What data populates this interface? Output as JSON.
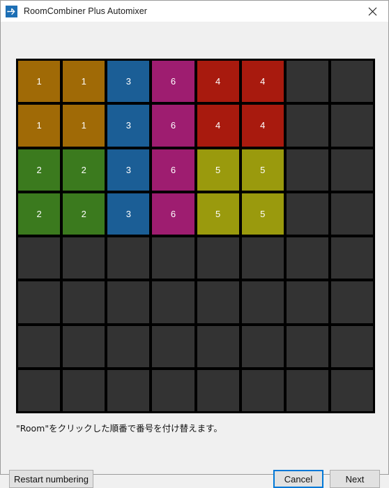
{
  "window": {
    "title": "RoomCombiner Plus Automixer",
    "app_icon": "mixer-node-icon",
    "close_icon": "close-icon"
  },
  "grid": {
    "columns": 8,
    "rows": 8,
    "empty_color": "#333333",
    "gridline_color": "#000000",
    "group_colors": {
      "1": "#a06a06",
      "2": "#3b7a1e",
      "3": "#1b5e96",
      "4": "#a81a0e",
      "5": "#9a9a0d",
      "6": "#9e1d70"
    },
    "cells": [
      [
        {
          "label": "1",
          "color": "#a06a06"
        },
        {
          "label": "1",
          "color": "#a06a06"
        },
        {
          "label": "3",
          "color": "#1b5e96"
        },
        {
          "label": "6",
          "color": "#9e1d70"
        },
        {
          "label": "4",
          "color": "#a81a0e"
        },
        {
          "label": "4",
          "color": "#a81a0e"
        },
        {
          "label": "",
          "color": "#333333"
        },
        {
          "label": "",
          "color": "#333333"
        }
      ],
      [
        {
          "label": "1",
          "color": "#a06a06"
        },
        {
          "label": "1",
          "color": "#a06a06"
        },
        {
          "label": "3",
          "color": "#1b5e96"
        },
        {
          "label": "6",
          "color": "#9e1d70"
        },
        {
          "label": "4",
          "color": "#a81a0e"
        },
        {
          "label": "4",
          "color": "#a81a0e"
        },
        {
          "label": "",
          "color": "#333333"
        },
        {
          "label": "",
          "color": "#333333"
        }
      ],
      [
        {
          "label": "2",
          "color": "#3b7a1e"
        },
        {
          "label": "2",
          "color": "#3b7a1e"
        },
        {
          "label": "3",
          "color": "#1b5e96"
        },
        {
          "label": "6",
          "color": "#9e1d70"
        },
        {
          "label": "5",
          "color": "#9a9a0d"
        },
        {
          "label": "5",
          "color": "#9a9a0d"
        },
        {
          "label": "",
          "color": "#333333"
        },
        {
          "label": "",
          "color": "#333333"
        }
      ],
      [
        {
          "label": "2",
          "color": "#3b7a1e"
        },
        {
          "label": "2",
          "color": "#3b7a1e"
        },
        {
          "label": "3",
          "color": "#1b5e96"
        },
        {
          "label": "6",
          "color": "#9e1d70"
        },
        {
          "label": "5",
          "color": "#9a9a0d"
        },
        {
          "label": "5",
          "color": "#9a9a0d"
        },
        {
          "label": "",
          "color": "#333333"
        },
        {
          "label": "",
          "color": "#333333"
        }
      ],
      [
        {
          "label": "",
          "color": "#333333"
        },
        {
          "label": "",
          "color": "#333333"
        },
        {
          "label": "",
          "color": "#333333"
        },
        {
          "label": "",
          "color": "#333333"
        },
        {
          "label": "",
          "color": "#333333"
        },
        {
          "label": "",
          "color": "#333333"
        },
        {
          "label": "",
          "color": "#333333"
        },
        {
          "label": "",
          "color": "#333333"
        }
      ],
      [
        {
          "label": "",
          "color": "#333333"
        },
        {
          "label": "",
          "color": "#333333"
        },
        {
          "label": "",
          "color": "#333333"
        },
        {
          "label": "",
          "color": "#333333"
        },
        {
          "label": "",
          "color": "#333333"
        },
        {
          "label": "",
          "color": "#333333"
        },
        {
          "label": "",
          "color": "#333333"
        },
        {
          "label": "",
          "color": "#333333"
        }
      ],
      [
        {
          "label": "",
          "color": "#333333"
        },
        {
          "label": "",
          "color": "#333333"
        },
        {
          "label": "",
          "color": "#333333"
        },
        {
          "label": "",
          "color": "#333333"
        },
        {
          "label": "",
          "color": "#333333"
        },
        {
          "label": "",
          "color": "#333333"
        },
        {
          "label": "",
          "color": "#333333"
        },
        {
          "label": "",
          "color": "#333333"
        }
      ],
      [
        {
          "label": "",
          "color": "#333333"
        },
        {
          "label": "",
          "color": "#333333"
        },
        {
          "label": "",
          "color": "#333333"
        },
        {
          "label": "",
          "color": "#333333"
        },
        {
          "label": "",
          "color": "#333333"
        },
        {
          "label": "",
          "color": "#333333"
        },
        {
          "label": "",
          "color": "#333333"
        },
        {
          "label": "",
          "color": "#333333"
        }
      ]
    ]
  },
  "caption": "\"Room\"をクリックした順番で番号を付け替えます。",
  "buttons": {
    "restart": "Restart numbering",
    "cancel": "Cancel",
    "next": "Next",
    "focus_color": "#0078d7"
  }
}
